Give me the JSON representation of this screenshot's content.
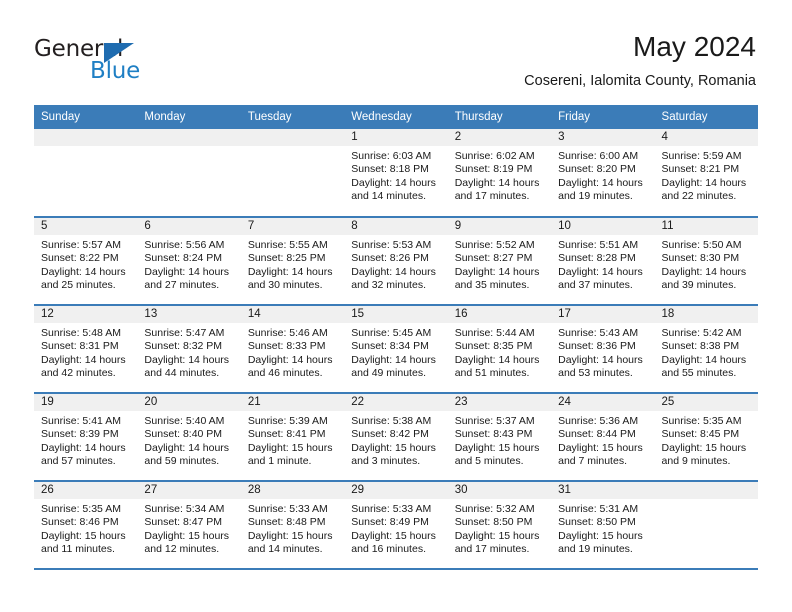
{
  "brand": {
    "name_part1": "General",
    "name_part2": "Blue",
    "triangle_color": "#1f6cb0",
    "blue_color": "#1f7fc4",
    "logo_icon": "triangle-flag-icon"
  },
  "header": {
    "title": "May 2024",
    "subtitle": "Cosereni, Ialomita County, Romania"
  },
  "theme": {
    "header_bg": "#3b7cb8",
    "daynum_bg": "#f0f0f0",
    "row_divider": "#3b7cb8",
    "text": "#1a1a1a"
  },
  "calendar": {
    "weekday_headers": [
      "Sunday",
      "Monday",
      "Tuesday",
      "Wednesday",
      "Thursday",
      "Friday",
      "Saturday"
    ],
    "weeks": [
      [
        {
          "day": "",
          "sunrise": "",
          "sunset": "",
          "daylight_line1": "",
          "daylight_line2": "",
          "empty": true
        },
        {
          "day": "",
          "sunrise": "",
          "sunset": "",
          "daylight_line1": "",
          "daylight_line2": "",
          "empty": true
        },
        {
          "day": "",
          "sunrise": "",
          "sunset": "",
          "daylight_line1": "",
          "daylight_line2": "",
          "empty": true
        },
        {
          "day": "1",
          "sunrise": "Sunrise: 6:03 AM",
          "sunset": "Sunset: 8:18 PM",
          "daylight_line1": "Daylight: 14 hours",
          "daylight_line2": "and 14 minutes."
        },
        {
          "day": "2",
          "sunrise": "Sunrise: 6:02 AM",
          "sunset": "Sunset: 8:19 PM",
          "daylight_line1": "Daylight: 14 hours",
          "daylight_line2": "and 17 minutes."
        },
        {
          "day": "3",
          "sunrise": "Sunrise: 6:00 AM",
          "sunset": "Sunset: 8:20 PM",
          "daylight_line1": "Daylight: 14 hours",
          "daylight_line2": "and 19 minutes."
        },
        {
          "day": "4",
          "sunrise": "Sunrise: 5:59 AM",
          "sunset": "Sunset: 8:21 PM",
          "daylight_line1": "Daylight: 14 hours",
          "daylight_line2": "and 22 minutes."
        }
      ],
      [
        {
          "day": "5",
          "sunrise": "Sunrise: 5:57 AM",
          "sunset": "Sunset: 8:22 PM",
          "daylight_line1": "Daylight: 14 hours",
          "daylight_line2": "and 25 minutes."
        },
        {
          "day": "6",
          "sunrise": "Sunrise: 5:56 AM",
          "sunset": "Sunset: 8:24 PM",
          "daylight_line1": "Daylight: 14 hours",
          "daylight_line2": "and 27 minutes."
        },
        {
          "day": "7",
          "sunrise": "Sunrise: 5:55 AM",
          "sunset": "Sunset: 8:25 PM",
          "daylight_line1": "Daylight: 14 hours",
          "daylight_line2": "and 30 minutes."
        },
        {
          "day": "8",
          "sunrise": "Sunrise: 5:53 AM",
          "sunset": "Sunset: 8:26 PM",
          "daylight_line1": "Daylight: 14 hours",
          "daylight_line2": "and 32 minutes."
        },
        {
          "day": "9",
          "sunrise": "Sunrise: 5:52 AM",
          "sunset": "Sunset: 8:27 PM",
          "daylight_line1": "Daylight: 14 hours",
          "daylight_line2": "and 35 minutes."
        },
        {
          "day": "10",
          "sunrise": "Sunrise: 5:51 AM",
          "sunset": "Sunset: 8:28 PM",
          "daylight_line1": "Daylight: 14 hours",
          "daylight_line2": "and 37 minutes."
        },
        {
          "day": "11",
          "sunrise": "Sunrise: 5:50 AM",
          "sunset": "Sunset: 8:30 PM",
          "daylight_line1": "Daylight: 14 hours",
          "daylight_line2": "and 39 minutes."
        }
      ],
      [
        {
          "day": "12",
          "sunrise": "Sunrise: 5:48 AM",
          "sunset": "Sunset: 8:31 PM",
          "daylight_line1": "Daylight: 14 hours",
          "daylight_line2": "and 42 minutes."
        },
        {
          "day": "13",
          "sunrise": "Sunrise: 5:47 AM",
          "sunset": "Sunset: 8:32 PM",
          "daylight_line1": "Daylight: 14 hours",
          "daylight_line2": "and 44 minutes."
        },
        {
          "day": "14",
          "sunrise": "Sunrise: 5:46 AM",
          "sunset": "Sunset: 8:33 PM",
          "daylight_line1": "Daylight: 14 hours",
          "daylight_line2": "and 46 minutes."
        },
        {
          "day": "15",
          "sunrise": "Sunrise: 5:45 AM",
          "sunset": "Sunset: 8:34 PM",
          "daylight_line1": "Daylight: 14 hours",
          "daylight_line2": "and 49 minutes."
        },
        {
          "day": "16",
          "sunrise": "Sunrise: 5:44 AM",
          "sunset": "Sunset: 8:35 PM",
          "daylight_line1": "Daylight: 14 hours",
          "daylight_line2": "and 51 minutes."
        },
        {
          "day": "17",
          "sunrise": "Sunrise: 5:43 AM",
          "sunset": "Sunset: 8:36 PM",
          "daylight_line1": "Daylight: 14 hours",
          "daylight_line2": "and 53 minutes."
        },
        {
          "day": "18",
          "sunrise": "Sunrise: 5:42 AM",
          "sunset": "Sunset: 8:38 PM",
          "daylight_line1": "Daylight: 14 hours",
          "daylight_line2": "and 55 minutes."
        }
      ],
      [
        {
          "day": "19",
          "sunrise": "Sunrise: 5:41 AM",
          "sunset": "Sunset: 8:39 PM",
          "daylight_line1": "Daylight: 14 hours",
          "daylight_line2": "and 57 minutes."
        },
        {
          "day": "20",
          "sunrise": "Sunrise: 5:40 AM",
          "sunset": "Sunset: 8:40 PM",
          "daylight_line1": "Daylight: 14 hours",
          "daylight_line2": "and 59 minutes."
        },
        {
          "day": "21",
          "sunrise": "Sunrise: 5:39 AM",
          "sunset": "Sunset: 8:41 PM",
          "daylight_line1": "Daylight: 15 hours",
          "daylight_line2": "and 1 minute."
        },
        {
          "day": "22",
          "sunrise": "Sunrise: 5:38 AM",
          "sunset": "Sunset: 8:42 PM",
          "daylight_line1": "Daylight: 15 hours",
          "daylight_line2": "and 3 minutes."
        },
        {
          "day": "23",
          "sunrise": "Sunrise: 5:37 AM",
          "sunset": "Sunset: 8:43 PM",
          "daylight_line1": "Daylight: 15 hours",
          "daylight_line2": "and 5 minutes."
        },
        {
          "day": "24",
          "sunrise": "Sunrise: 5:36 AM",
          "sunset": "Sunset: 8:44 PM",
          "daylight_line1": "Daylight: 15 hours",
          "daylight_line2": "and 7 minutes."
        },
        {
          "day": "25",
          "sunrise": "Sunrise: 5:35 AM",
          "sunset": "Sunset: 8:45 PM",
          "daylight_line1": "Daylight: 15 hours",
          "daylight_line2": "and 9 minutes."
        }
      ],
      [
        {
          "day": "26",
          "sunrise": "Sunrise: 5:35 AM",
          "sunset": "Sunset: 8:46 PM",
          "daylight_line1": "Daylight: 15 hours",
          "daylight_line2": "and 11 minutes."
        },
        {
          "day": "27",
          "sunrise": "Sunrise: 5:34 AM",
          "sunset": "Sunset: 8:47 PM",
          "daylight_line1": "Daylight: 15 hours",
          "daylight_line2": "and 12 minutes."
        },
        {
          "day": "28",
          "sunrise": "Sunrise: 5:33 AM",
          "sunset": "Sunset: 8:48 PM",
          "daylight_line1": "Daylight: 15 hours",
          "daylight_line2": "and 14 minutes."
        },
        {
          "day": "29",
          "sunrise": "Sunrise: 5:33 AM",
          "sunset": "Sunset: 8:49 PM",
          "daylight_line1": "Daylight: 15 hours",
          "daylight_line2": "and 16 minutes."
        },
        {
          "day": "30",
          "sunrise": "Sunrise: 5:32 AM",
          "sunset": "Sunset: 8:50 PM",
          "daylight_line1": "Daylight: 15 hours",
          "daylight_line2": "and 17 minutes."
        },
        {
          "day": "31",
          "sunrise": "Sunrise: 5:31 AM",
          "sunset": "Sunset: 8:50 PM",
          "daylight_line1": "Daylight: 15 hours",
          "daylight_line2": "and 19 minutes."
        },
        {
          "day": "",
          "sunrise": "",
          "sunset": "",
          "daylight_line1": "",
          "daylight_line2": "",
          "empty": true
        }
      ]
    ]
  }
}
